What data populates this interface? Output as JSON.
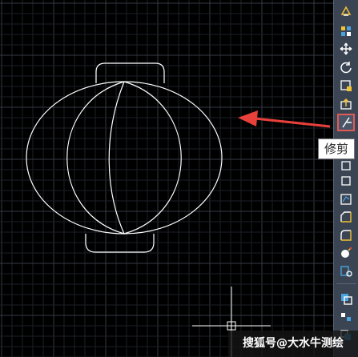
{
  "tooltip": {
    "text": "修剪"
  },
  "watermark": {
    "text": "搜狐号@大水牛测绘"
  },
  "toolbar": {
    "tools": [
      "annotate-icon",
      "array-icon",
      "move-icon",
      "rotate-icon",
      "scale-icon",
      "stretch-icon",
      "trim-icon",
      "extend-icon",
      "break-icon",
      "join-icon",
      "chamfer-icon",
      "fillet-icon",
      "explode-icon",
      "properties-icon",
      "copy-icon",
      "mirror-icon",
      "offset-icon"
    ],
    "active_tool": "trim-icon"
  },
  "colors": {
    "background": "#000000",
    "grid_major": "#343a45",
    "grid_minor": "#1b1f26",
    "drawing": "#ffffff",
    "arrow": "#e8403b",
    "active_tool_border": "#e25a55"
  }
}
